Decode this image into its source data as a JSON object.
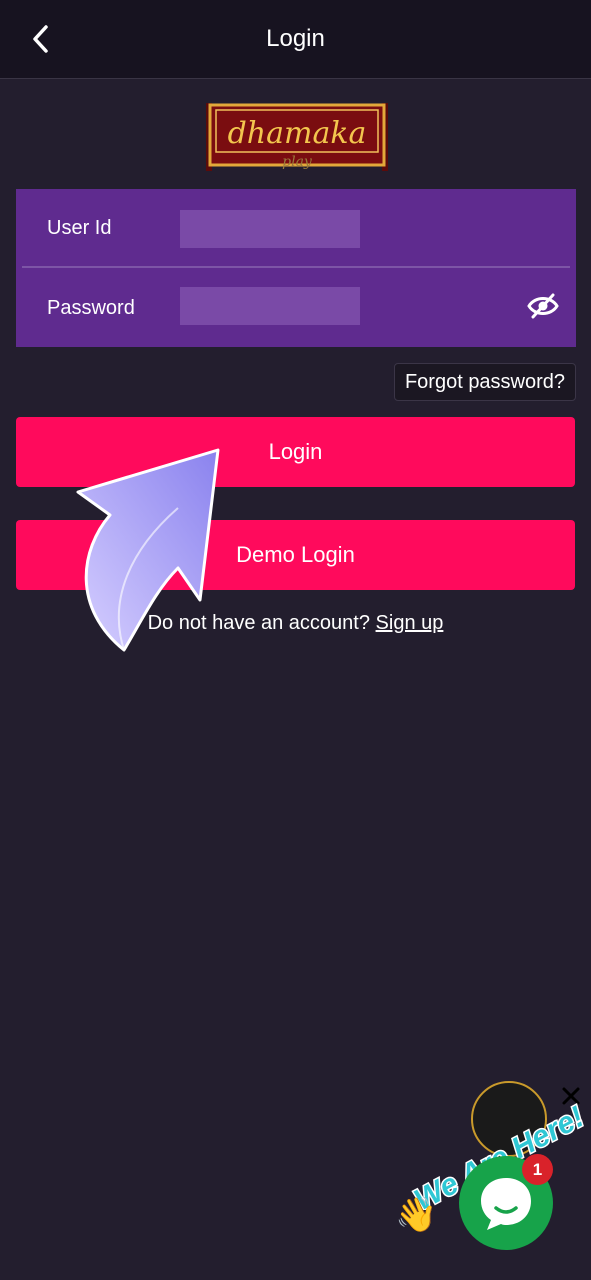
{
  "header": {
    "title": "Login"
  },
  "brand": {
    "logo_main": "dhamaka",
    "logo_sub": "play"
  },
  "form": {
    "user_id_label": "User Id",
    "password_label": "Password",
    "user_id_value": "",
    "password_value": ""
  },
  "actions": {
    "forgot_label": "Forgot password?",
    "login_label": "Login",
    "demo_label": "Demo Login",
    "no_account_text": "Do not have an account?",
    "signup_label": "Sign up"
  },
  "widget": {
    "banner_text": "We Are Here!",
    "badge_count": "1"
  },
  "icons": {
    "back": "chevron-left-icon",
    "password_toggle": "eye-slash-icon",
    "chat": "chat-bubble-icon",
    "close": "close-icon",
    "wave": "waving-hand-icon"
  },
  "colors": {
    "background": "#231e2e",
    "header": "#171320",
    "form": "#5f2b8f",
    "primary_button": "#ff0a5c",
    "chat": "#17a34a",
    "badge": "#d9222a"
  }
}
